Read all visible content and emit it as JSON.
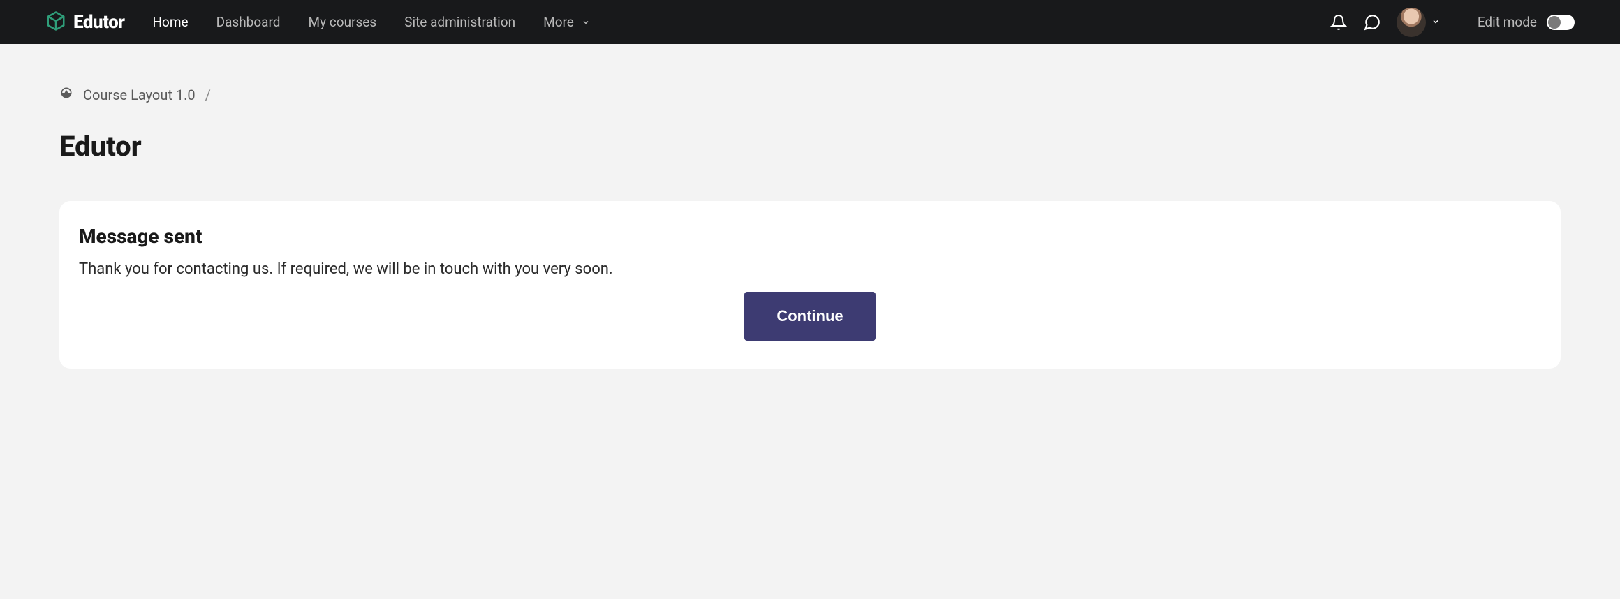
{
  "brand": {
    "name": "Edutor"
  },
  "nav": {
    "items": [
      {
        "label": "Home",
        "active": true
      },
      {
        "label": "Dashboard",
        "active": false
      },
      {
        "label": "My courses",
        "active": false
      },
      {
        "label": "Site administration",
        "active": false
      },
      {
        "label": "More",
        "active": false,
        "dropdown": true
      }
    ],
    "edit_mode_label": "Edit mode",
    "edit_mode_on": false
  },
  "icons": {
    "notifications": "bell-icon",
    "messages": "chat-icon",
    "user_dropdown": "chevron-down-icon"
  },
  "breadcrumb": {
    "home_icon": "dashboard-icon",
    "items": [
      {
        "label": "Course Layout 1.0"
      }
    ],
    "sep": "/"
  },
  "page": {
    "title": "Edutor"
  },
  "card": {
    "title": "Message sent",
    "body": "Thank you for contacting us. If required, we will be in touch with you very soon.",
    "button": "Continue"
  },
  "colors": {
    "navbar_bg": "#18191b",
    "page_bg": "#f3f3f3",
    "primary_btn": "#3d3b72",
    "brand_accent": "#2f9e7a"
  }
}
